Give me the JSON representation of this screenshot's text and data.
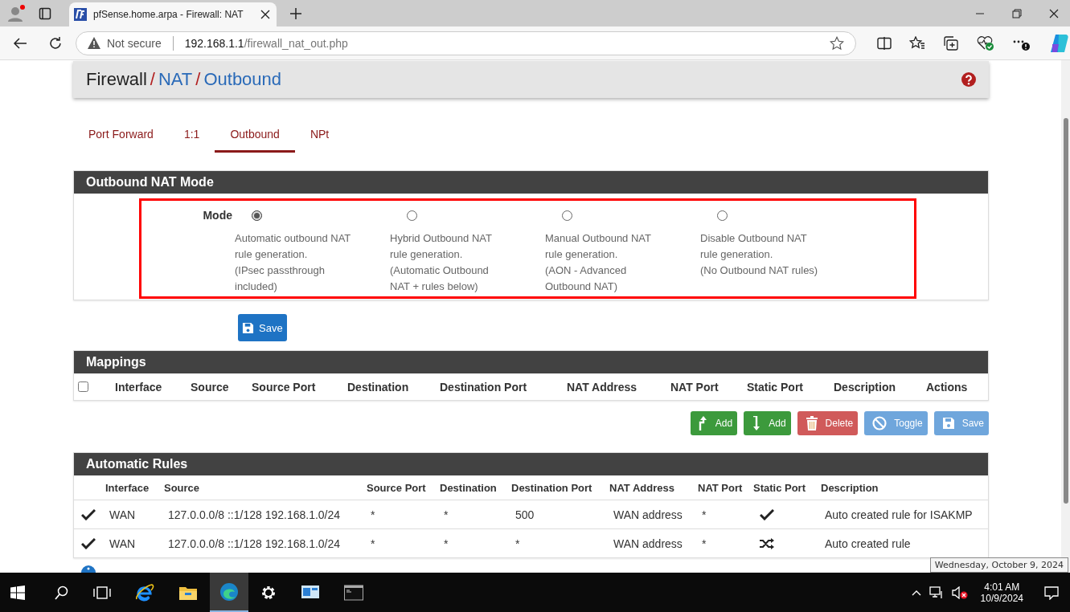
{
  "browser": {
    "tab_title": "pfSense.home.arpa - Firewall: NAT",
    "security": "Not secure",
    "url_host": "192.168.1.1",
    "url_path": "/firewall_nat_out.php"
  },
  "breadcrumb": [
    {
      "label": "Firewall",
      "kind": "text",
      "separator": "/"
    },
    {
      "label": "NAT",
      "kind": "link",
      "separator": "/"
    },
    {
      "label": "Outbound",
      "kind": "link"
    }
  ],
  "tabs": [
    {
      "label": "Port Forward",
      "selected": false
    },
    {
      "label": "1:1",
      "selected": false
    },
    {
      "label": "Outbound",
      "selected": true
    },
    {
      "label": "NPt",
      "selected": false
    }
  ],
  "mode_panel": {
    "title": "Outbound NAT Mode",
    "label": "Mode",
    "options": [
      {
        "text": "Automatic outbound NAT\nrule generation.\n(IPsec passthrough\nincluded)",
        "selected": true
      },
      {
        "text": "Hybrid Outbound NAT\nrule generation.\n(Automatic Outbound\nNAT + rules below)",
        "selected": false
      },
      {
        "text": "Manual Outbound NAT\nrule generation.\n(AON - Advanced\nOutbound NAT)",
        "selected": false
      },
      {
        "text": "Disable Outbound NAT\nrule generation.\n(No Outbound NAT rules)",
        "selected": false
      }
    ],
    "save": "Save"
  },
  "mappings": {
    "title": "Mappings",
    "select_all_checked": false,
    "columns": [
      "Interface",
      "Source",
      "Source Port",
      "Destination",
      "Destination Port",
      "NAT Address",
      "NAT Port",
      "Static Port",
      "Description",
      "Actions"
    ],
    "buttons": [
      {
        "label": "Add",
        "kind": "add-top"
      },
      {
        "label": "Add",
        "kind": "add-bottom"
      },
      {
        "label": "Delete",
        "kind": "delete"
      },
      {
        "label": "Toggle",
        "kind": "toggle"
      },
      {
        "label": "Save",
        "kind": "save"
      }
    ]
  },
  "automatic_rules": {
    "title": "Automatic Rules",
    "columns": [
      "Interface",
      "Source",
      "Source Port",
      "Destination",
      "Destination Port",
      "NAT Address",
      "NAT Port",
      "Static Port",
      "Description"
    ],
    "rows": [
      {
        "enabled": true,
        "interface": "WAN",
        "source": "127.0.0.0/8 ::1/128 192.168.1.0/24",
        "source_port": "*",
        "destination": "*",
        "destination_port": "500",
        "nat_address": "WAN address",
        "nat_port": "*",
        "static_port": true,
        "description": "Auto created rule for ISAKMP"
      },
      {
        "enabled": true,
        "interface": "WAN",
        "source": "127.0.0.0/8 ::1/128 192.168.1.0/24",
        "source_port": "*",
        "destination": "*",
        "destination_port": "*",
        "nat_address": "WAN address",
        "nat_port": "*",
        "static_port": false,
        "description": "Auto created rule"
      }
    ]
  },
  "tooltip": "Wednesday, October 9, 2024",
  "taskbar": {
    "time": "4:01 AM",
    "date": "10/9/2024"
  }
}
